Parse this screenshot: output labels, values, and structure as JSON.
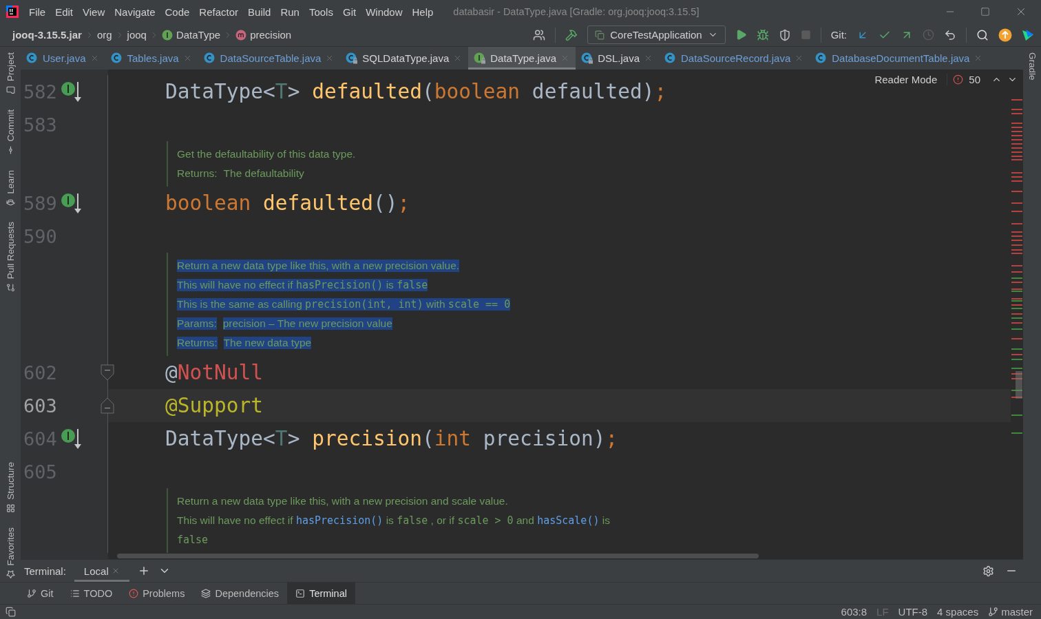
{
  "window": {
    "title": "databasir - DataType.java [Gradle: org.jooq:jooq:3.15.5]"
  },
  "menu": [
    "File",
    "Edit",
    "View",
    "Navigate",
    "Code",
    "Refactor",
    "Build",
    "Run",
    "Tools",
    "Git",
    "Window",
    "Help"
  ],
  "breadcrumbs": [
    {
      "label": "jooq-3.15.5.jar",
      "kind": "jar"
    },
    {
      "label": "org",
      "kind": "package"
    },
    {
      "label": "jooq",
      "kind": "package"
    },
    {
      "label": "DataType",
      "kind": "interface"
    },
    {
      "label": "precision",
      "kind": "method"
    }
  ],
  "toolbar": {
    "run_configuration": "CoreTestApplication",
    "git_label": "Git:"
  },
  "left_tool_windows": {
    "top": [
      {
        "label": "Project",
        "kind": "project"
      },
      {
        "label": "Commit",
        "kind": "commit"
      },
      {
        "label": "Learn",
        "kind": "learn"
      },
      {
        "label": "Pull Requests",
        "kind": "pull_requests"
      }
    ],
    "bottom": [
      {
        "label": "Structure",
        "kind": "structure"
      },
      {
        "label": "Favorites",
        "kind": "favorites"
      }
    ]
  },
  "right_tool_windows": [
    {
      "label": "Gradle"
    }
  ],
  "tabs": [
    {
      "label": "User.java",
      "kind": "class",
      "locked": false,
      "selected": false,
      "color": "#6e9fd6"
    },
    {
      "label": "Tables.java",
      "kind": "class",
      "locked": false,
      "selected": false,
      "color": "#6e9fd6"
    },
    {
      "label": "DataSourceTable.java",
      "kind": "class",
      "locked": false,
      "selected": false,
      "color": "#6e9fd6"
    },
    {
      "label": "SQLDataType.java",
      "kind": "class",
      "locked": true,
      "selected": false,
      "color": "#d4d4d4"
    },
    {
      "label": "DataType.java",
      "kind": "interface",
      "locked": true,
      "selected": true,
      "color": "#d4d4d4"
    },
    {
      "label": "DSL.java",
      "kind": "class",
      "locked": true,
      "selected": false,
      "color": "#d4d4d4"
    },
    {
      "label": "DataSourceRecord.java",
      "kind": "class",
      "locked": false,
      "selected": false,
      "color": "#6e9fd6"
    },
    {
      "label": "DatabaseDocumentTable.java",
      "kind": "class",
      "locked": false,
      "selected": false,
      "color": "#6e9fd6"
    }
  ],
  "editor": {
    "reader_mode": "Reader Mode",
    "problems": "50",
    "rows": [
      {
        "kind": "code",
        "line": "582",
        "implemented": true,
        "fold_start": false,
        "fold_end": false,
        "current": false,
        "tokens": [
          {
            "text": "DataType<",
            "kind": "plain"
          },
          {
            "text": "T",
            "kind": "type_param"
          },
          {
            "text": "> ",
            "kind": "plain"
          },
          {
            "text": "defaulted",
            "kind": "method"
          },
          {
            "text": "(",
            "kind": "plain"
          },
          {
            "text": "boolean",
            "kind": "keyword"
          },
          {
            "text": " defaulted)",
            "kind": "plain"
          },
          {
            "text": ";",
            "kind": "keyword"
          }
        ]
      },
      {
        "kind": "code",
        "line": "583",
        "implemented": false,
        "fold_start": false,
        "fold_end": false,
        "current": false
      },
      {
        "kind": "doc",
        "lines": [
          {
            "selected": false,
            "segments": [
              {
                "text": "Get the defaultability of this data type.",
                "kind": "text"
              }
            ]
          },
          {
            "selected": false,
            "segments": [
              {
                "text": "Returns:",
                "kind": "label"
              },
              {
                "text": "The defaultability",
                "kind": "text"
              }
            ]
          }
        ]
      },
      {
        "kind": "code",
        "line": "589",
        "implemented": true,
        "fold_start": false,
        "fold_end": false,
        "current": false,
        "tokens": [
          {
            "text": "boolean",
            "kind": "keyword"
          },
          {
            "text": " defaulted",
            "kind": "method"
          },
          {
            "text": "()",
            "kind": "plain"
          },
          {
            "text": ";",
            "kind": "keyword"
          }
        ]
      },
      {
        "kind": "code",
        "line": "590",
        "implemented": false,
        "fold_start": false,
        "fold_end": false,
        "current": false
      },
      {
        "kind": "doc",
        "lines": [
          {
            "selected": true,
            "segments": [
              {
                "text": "Return a new data type like this, with a new precision value.",
                "kind": "text"
              }
            ]
          },
          {
            "selected": true,
            "segments": [
              {
                "text": "This will have no effect if ",
                "kind": "text"
              },
              {
                "text": "hasPrecision()",
                "kind": "code"
              },
              {
                "text": " is ",
                "kind": "text"
              },
              {
                "text": "false",
                "kind": "code"
              }
            ]
          },
          {
            "selected": true,
            "segments": [
              {
                "text": "This is the same as calling ",
                "kind": "text"
              },
              {
                "text": "precision(int, int)",
                "kind": "code"
              },
              {
                "text": " with ",
                "kind": "text"
              },
              {
                "text": "scale == 0",
                "kind": "code"
              }
            ]
          },
          {
            "selected": true,
            "segments": [
              {
                "text": "Params:",
                "kind": "label"
              },
              {
                "text": "precision – The new precision value",
                "kind": "text"
              }
            ]
          },
          {
            "selected": true,
            "segments": [
              {
                "text": "Returns:",
                "kind": "label"
              },
              {
                "text": "The new data type",
                "kind": "text"
              }
            ]
          }
        ]
      },
      {
        "kind": "code",
        "line": "602",
        "implemented": false,
        "fold_start": true,
        "fold_end": false,
        "current": false,
        "tokens": [
          {
            "text": "@",
            "kind": "plain"
          },
          {
            "text": "NotNull",
            "kind": "error"
          }
        ]
      },
      {
        "kind": "code",
        "line": "603",
        "implemented": false,
        "fold_start": false,
        "fold_end": true,
        "current": true,
        "tokens": [
          {
            "text": "@Support",
            "kind": "annotation"
          }
        ]
      },
      {
        "kind": "code",
        "line": "604",
        "implemented": true,
        "fold_start": false,
        "fold_end": false,
        "current": false,
        "tokens": [
          {
            "text": "DataType<",
            "kind": "plain"
          },
          {
            "text": "T",
            "kind": "type_param"
          },
          {
            "text": "> ",
            "kind": "plain"
          },
          {
            "text": "precision",
            "kind": "method"
          },
          {
            "text": "(",
            "kind": "plain"
          },
          {
            "text": "int",
            "kind": "keyword"
          },
          {
            "text": " precision)",
            "kind": "plain"
          },
          {
            "text": ";",
            "kind": "keyword"
          }
        ]
      },
      {
        "kind": "code",
        "line": "605",
        "implemented": false,
        "fold_start": false,
        "fold_end": false,
        "current": false
      },
      {
        "kind": "doc",
        "lines": [
          {
            "selected": false,
            "segments": [
              {
                "text": "Return a new data type like this, with a new precision and scale value.",
                "kind": "text"
              }
            ]
          },
          {
            "selected": false,
            "segments": [
              {
                "text": "This will have no effect if ",
                "kind": "text"
              },
              {
                "text": "hasPrecision()",
                "kind": "link"
              },
              {
                "text": " is ",
                "kind": "text"
              },
              {
                "text": "false",
                "kind": "code"
              },
              {
                "text": " , or if ",
                "kind": "text"
              },
              {
                "text": "scale > 0",
                "kind": "code"
              },
              {
                "text": " and ",
                "kind": "text"
              },
              {
                "text": "hasScale()",
                "kind": "link"
              },
              {
                "text": " is",
                "kind": "text"
              }
            ]
          },
          {
            "selected": false,
            "segments": [
              {
                "text": "false",
                "kind": "code"
              }
            ]
          }
        ]
      }
    ]
  },
  "terminal": {
    "label": "Terminal:",
    "sessions": [
      {
        "label": "Local",
        "selected": true
      }
    ]
  },
  "tool_tabs": [
    {
      "label": "Git",
      "kind": "git",
      "selected": false
    },
    {
      "label": "TODO",
      "kind": "todo",
      "selected": false
    },
    {
      "label": "Problems",
      "kind": "problems",
      "selected": false
    },
    {
      "label": "Dependencies",
      "kind": "dependencies",
      "selected": false
    },
    {
      "label": "Terminal",
      "kind": "terminal",
      "selected": true
    }
  ],
  "status_bar": {
    "position": "603:8",
    "line_separator": "LF",
    "encoding": "UTF-8",
    "indent": "4 spaces",
    "branch": "master"
  }
}
